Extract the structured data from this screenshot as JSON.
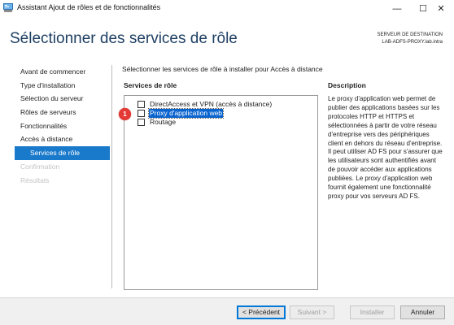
{
  "window": {
    "title": "Assistant Ajout de rôles et de fonctionnalités",
    "minimize_glyph": "—",
    "maximize_glyph": "☐",
    "close_glyph": "✕",
    "app_icon": "server-manager-icon"
  },
  "header": {
    "title": "Sélectionner des services de rôle",
    "destination_label": "SERVEUR DE DESTINATION",
    "destination_server": "LAB-ADFS-PROXY.lab.intra"
  },
  "nav": {
    "items": [
      {
        "label": "Avant de commencer",
        "state": "normal"
      },
      {
        "label": "Type d'installation",
        "state": "normal"
      },
      {
        "label": "Sélection du serveur",
        "state": "normal"
      },
      {
        "label": "Rôles de serveurs",
        "state": "normal"
      },
      {
        "label": "Fonctionnalités",
        "state": "normal"
      },
      {
        "label": "Accès à distance",
        "state": "normal"
      },
      {
        "label": "Services de rôle",
        "state": "active"
      },
      {
        "label": "Confirmation",
        "state": "disabled"
      },
      {
        "label": "Résultats",
        "state": "disabled"
      }
    ]
  },
  "main": {
    "instruction": "Sélectionner les services de rôle à installer pour Accès à distance",
    "services_header": "Services de rôle",
    "description_header": "Description",
    "services": [
      {
        "label": "DirectAccess et VPN (accès à distance)",
        "checked": false,
        "selected": false
      },
      {
        "label": "Proxy d'application web",
        "checked": false,
        "selected": true
      },
      {
        "label": "Routage",
        "checked": false,
        "selected": false
      }
    ],
    "annotation_badge": "1",
    "description": "Le proxy d'application web permet de publier des applications basées sur les protocoles HTTP et HTTPS et sélectionnées à partir de votre réseau d'entreprise vers des périphériques client en dehors du réseau d'entreprise. Il peut utiliser AD FS pour s'assurer que les utilisateurs sont authentifiés avant de pouvoir accéder aux applications publiées. Le proxy d'application web fournit également une fonctionnalité proxy pour vos serveurs AD FS."
  },
  "footer": {
    "previous": "< Précédent",
    "next": "Suivant >",
    "install": "Installer",
    "cancel": "Annuler"
  },
  "colors": {
    "title_blue": "#1e3f63",
    "nav_active": "#1979ca",
    "selection": "#0a64cf",
    "badge_red": "#e53935"
  }
}
